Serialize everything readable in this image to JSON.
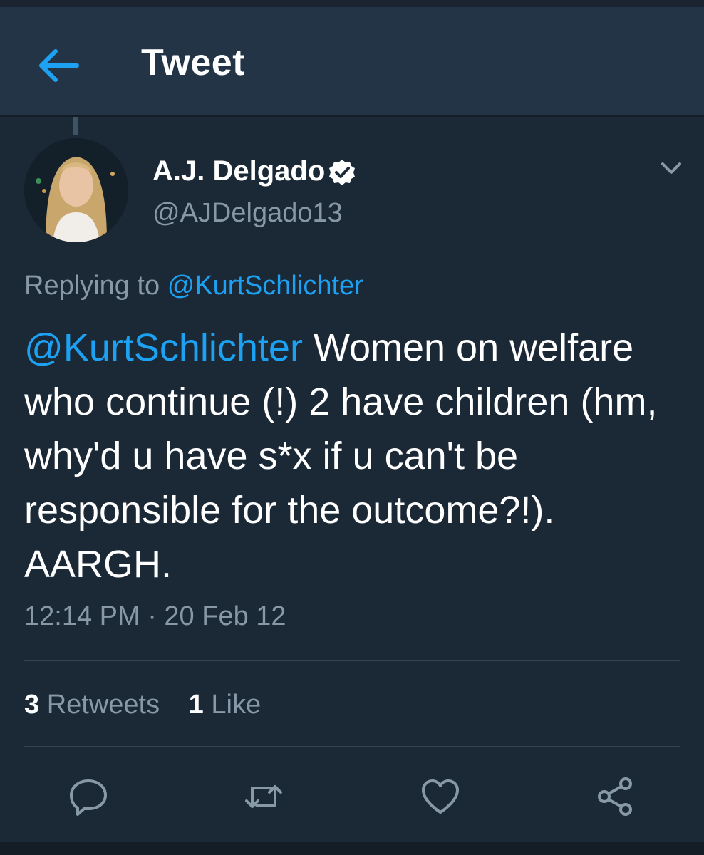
{
  "header": {
    "back_icon": "arrow-left-icon",
    "title": "Tweet"
  },
  "tweet": {
    "author": {
      "name": "A.J. Delgado",
      "handle": "@AJDelgado13",
      "verified": true
    },
    "replying_label": "Replying to",
    "replying_to": "@KurtSchlichter",
    "mention": "@KurtSchlichter",
    "body": "Women on welfare who continue (!) 2 have children (hm, why'd u have s*x if u can't be responsible for the outcome?!). AARGH.",
    "timestamp": "12:14 PM · 20 Feb 12"
  },
  "stats": {
    "retweets_count": "3",
    "retweets_label": "Retweets",
    "likes_count": "1",
    "likes_label": "Like"
  },
  "actions": [
    "reply-icon",
    "retweet-icon",
    "like-icon",
    "share-icon"
  ],
  "colors": {
    "background": "#1b2836",
    "header": "#243447",
    "accent": "#1da1f2",
    "secondary_text": "#8899a6"
  }
}
